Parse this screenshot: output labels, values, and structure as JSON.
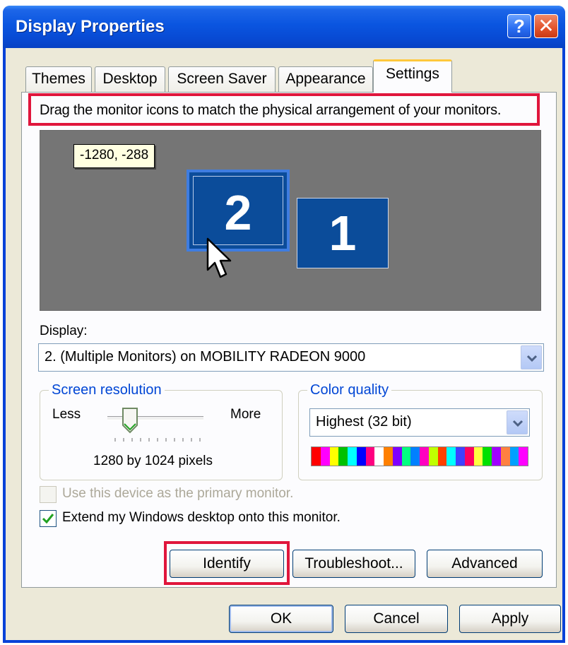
{
  "window": {
    "title": "Display Properties",
    "help_glyph": "?",
    "close_glyph": "✕"
  },
  "tabs": [
    {
      "label": "Themes",
      "active": false
    },
    {
      "label": "Desktop",
      "active": false
    },
    {
      "label": "Screen Saver",
      "active": false
    },
    {
      "label": "Appearance",
      "active": false
    },
    {
      "label": "Settings",
      "active": true
    }
  ],
  "settings": {
    "instruction": "Drag the monitor icons to match the physical arrangement of your monitors.",
    "coordinate_tooltip": "-1280, -288",
    "monitors": [
      {
        "number": "2",
        "selected": true
      },
      {
        "number": "1",
        "selected": false
      }
    ],
    "display_label": "Display:",
    "display_value": "2. (Multiple Monitors) on MOBILITY RADEON 9000",
    "resolution": {
      "legend": "Screen resolution",
      "less_label": "Less",
      "more_label": "More",
      "value_text": "1280 by 1024 pixels",
      "slider_position": 0.25
    },
    "color_quality": {
      "legend": "Color quality",
      "value": "Highest (32 bit)"
    },
    "primary_checkbox": {
      "label": "Use this device as the primary monitor.",
      "checked": false,
      "enabled": false
    },
    "extend_checkbox": {
      "label": "Extend my Windows desktop onto this monitor.",
      "checked": true,
      "enabled": true
    },
    "buttons": {
      "identify": "Identify",
      "troubleshoot": "Troubleshoot...",
      "advanced": "Advanced"
    }
  },
  "dialog_buttons": {
    "ok": "OK",
    "cancel": "Cancel",
    "apply": "Apply"
  },
  "colors": {
    "titlebar": "#0a55e0",
    "dialog_bg": "#ece9d8",
    "panel_bg": "#fcfcfe",
    "monitor_fill": "#0b4c9a",
    "arrange_bg": "#757575",
    "highlight_annotation": "#e0163c",
    "legend_text": "#0046d5",
    "active_tab_accent": "#ffc83c"
  },
  "icons": {
    "help": "question-mark-icon",
    "close": "close-x-icon",
    "dropdown": "chevron-down-icon",
    "cursor": "mouse-pointer-icon",
    "check": "checkmark-icon"
  }
}
